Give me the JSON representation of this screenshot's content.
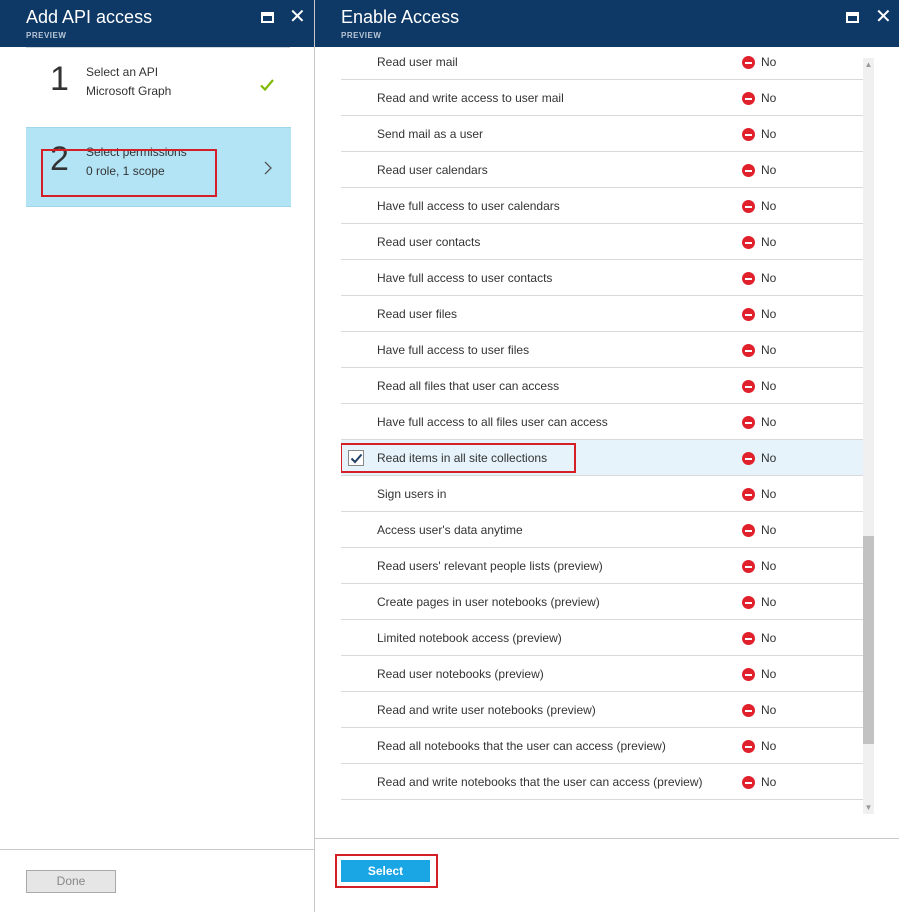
{
  "left_blade": {
    "title": "Add API access",
    "subtitle": "PREVIEW",
    "steps": [
      {
        "number": "1",
        "line1": "Select an API",
        "line2": "Microsoft Graph",
        "completed": true
      },
      {
        "number": "2",
        "line1": "Select permissions",
        "line2": "0 role, 1 scope",
        "selected": true
      }
    ],
    "done_label": "Done"
  },
  "right_blade": {
    "title": "Enable Access",
    "subtitle": "PREVIEW",
    "permissions": [
      {
        "label": "Read user mail",
        "value": "No",
        "checked": false
      },
      {
        "label": "Read and write access to user mail",
        "value": "No",
        "checked": false
      },
      {
        "label": "Send mail as a user",
        "value": "No",
        "checked": false
      },
      {
        "label": "Read user calendars",
        "value": "No",
        "checked": false
      },
      {
        "label": "Have full access to user calendars",
        "value": "No",
        "checked": false
      },
      {
        "label": "Read user contacts",
        "value": "No",
        "checked": false
      },
      {
        "label": "Have full access to user contacts",
        "value": "No",
        "checked": false
      },
      {
        "label": "Read user files",
        "value": "No",
        "checked": false
      },
      {
        "label": "Have full access to user files",
        "value": "No",
        "checked": false
      },
      {
        "label": "Read all files that user can access",
        "value": "No",
        "checked": false
      },
      {
        "label": "Have full access to all files user can access",
        "value": "No",
        "checked": false
      },
      {
        "label": "Read items in all site collections",
        "value": "No",
        "checked": true
      },
      {
        "label": "Sign users in",
        "value": "No",
        "checked": false
      },
      {
        "label": "Access user's data anytime",
        "value": "No",
        "checked": false
      },
      {
        "label": "Read users' relevant people lists (preview)",
        "value": "No",
        "checked": false
      },
      {
        "label": "Create pages in user notebooks (preview)",
        "value": "No",
        "checked": false
      },
      {
        "label": "Limited notebook access (preview)",
        "value": "No",
        "checked": false
      },
      {
        "label": "Read user notebooks (preview)",
        "value": "No",
        "checked": false
      },
      {
        "label": "Read and write user notebooks (preview)",
        "value": "No",
        "checked": false
      },
      {
        "label": "Read all notebooks that the user can access (preview)",
        "value": "No",
        "checked": false
      },
      {
        "label": "Read and write notebooks that the user can access (preview)",
        "value": "No",
        "checked": false
      }
    ],
    "select_label": "Select"
  },
  "colors": {
    "header": "#0e3966",
    "accent": "#1aa5e4",
    "highlight": "#d41f27",
    "selected_step": "#b3e4f6"
  },
  "icons": {
    "maximize": "maximize-icon",
    "close": "close-icon",
    "check": "checkmark-icon",
    "chevron": "chevron-right-icon",
    "denied": "no-entry-icon"
  }
}
